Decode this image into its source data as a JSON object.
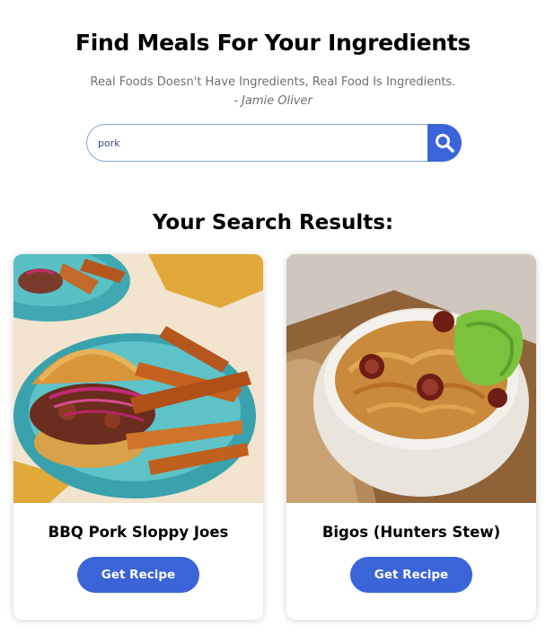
{
  "header": {
    "title": "Find Meals For Your Ingredients",
    "quote": "Real Foods Doesn't Have Ingredients, Real Food Is Ingredients.",
    "author": "- Jamie Oliver"
  },
  "search": {
    "value": "pork",
    "icon": "search-icon"
  },
  "results": {
    "heading": "Your Search Results:",
    "items": [
      {
        "name": "BBQ Pork Sloppy Joes",
        "button": "Get Recipe"
      },
      {
        "name": "Bigos (Hunters Stew)",
        "button": "Get Recipe"
      }
    ]
  },
  "colors": {
    "accent": "#3a64d8",
    "input_border": "#7fa2d8",
    "muted_text": "#6f6f6f"
  }
}
